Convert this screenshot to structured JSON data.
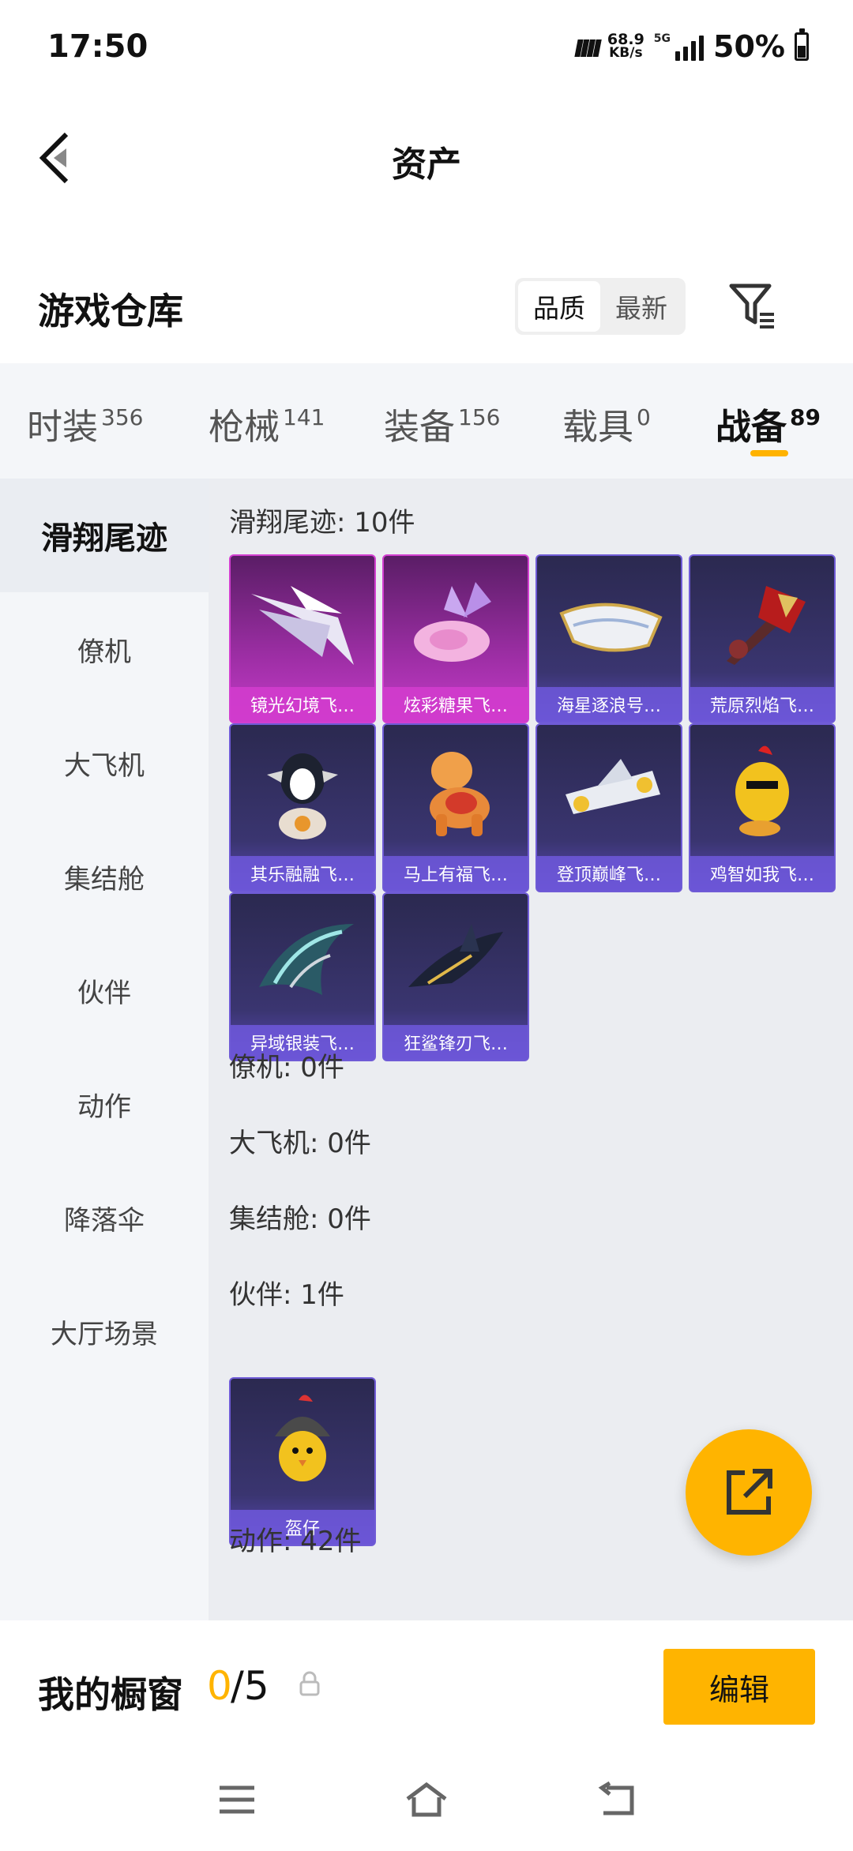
{
  "status_bar": {
    "time": "17:50",
    "network_speed_value": "68.9",
    "network_speed_unit": "KB/s",
    "network_type": "5G",
    "battery_percent": "50%",
    "battery_level": 0.5
  },
  "header": {
    "title": "资产"
  },
  "warehouse": {
    "title": "游戏仓库",
    "sort_options": [
      "品质",
      "最新"
    ],
    "sort_selected": "品质"
  },
  "tabs": [
    {
      "label": "时装",
      "count": "356"
    },
    {
      "label": "枪械",
      "count": "141"
    },
    {
      "label": "装备",
      "count": "156"
    },
    {
      "label": "载具",
      "count": "0"
    },
    {
      "label": "战备",
      "count": "89",
      "active": true
    }
  ],
  "sidebar": {
    "items": [
      "滑翔尾迹",
      "僚机",
      "大飞机",
      "集结舱",
      "伙伴",
      "动作",
      "降落伞",
      "大厅场景"
    ],
    "active": "滑翔尾迹"
  },
  "sections": {
    "glide_trail": {
      "label": "滑翔尾迹: 10件",
      "items": [
        {
          "name": "镜光幻境飞…",
          "rarity": "pink",
          "art": "wing-art"
        },
        {
          "name": "炫彩糖果飞…",
          "rarity": "pink",
          "art": "candy-art"
        },
        {
          "name": "海星逐浪号…",
          "rarity": "purple",
          "art": "boat-art"
        },
        {
          "name": "荒原烈焰飞…",
          "rarity": "purple",
          "art": "flame-art"
        },
        {
          "name": "其乐融融飞…",
          "rarity": "purple",
          "art": "penguin-art"
        },
        {
          "name": "马上有福飞…",
          "rarity": "purple",
          "art": "horse-art"
        },
        {
          "name": "登顶巅峰飞…",
          "rarity": "purple",
          "art": "jet-art"
        },
        {
          "name": "鸡智如我飞…",
          "rarity": "purple",
          "art": "chicken-art"
        },
        {
          "name": "异域银装飞…",
          "rarity": "purple",
          "art": "blade-art"
        },
        {
          "name": "狂鲨锋刃飞…",
          "rarity": "purple",
          "art": "shark-art"
        }
      ]
    },
    "wingman": {
      "label": "僚机: 0件"
    },
    "big_plane": {
      "label": "大飞机: 0件"
    },
    "rally_pod": {
      "label": "集结舱: 0件"
    },
    "partner": {
      "label": "伙伴: 1件",
      "items": [
        {
          "name": "盔仔",
          "rarity": "purple",
          "art": "helmet-chick-art"
        }
      ]
    },
    "action": {
      "label": "动作: 42件"
    }
  },
  "showcase": {
    "label": "我的橱窗",
    "used": "0",
    "total": "/5",
    "edit_label": "编辑"
  },
  "colors": {
    "accent": "#ffb400",
    "pink_rarity": "#d23fd0",
    "purple_rarity": "#6f5bd6"
  }
}
